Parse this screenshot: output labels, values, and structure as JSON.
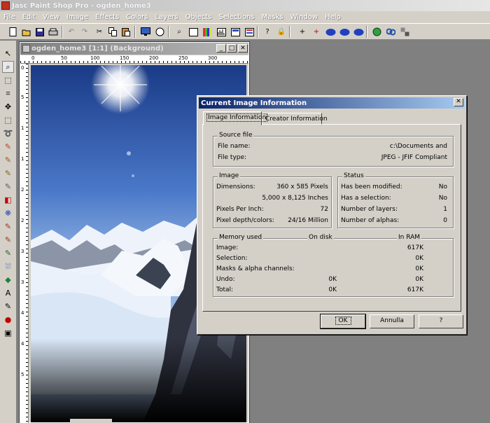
{
  "app": {
    "title": "Jasc Paint Shop Pro - ogden_home3"
  },
  "menu": [
    "File",
    "Edit",
    "View",
    "Image",
    "Effects",
    "Colors",
    "Layers",
    "Objects",
    "Selections",
    "Masks",
    "Window",
    "Help"
  ],
  "image_window": {
    "title": "ogden_home3 [1:1] (Background)",
    "minimize": "_",
    "maximize": "□",
    "close": "✕",
    "ruler_top": [
      "0",
      "50",
      "100",
      "150",
      "200",
      "250",
      "300"
    ],
    "ruler_left": [
      "0",
      "5",
      "1",
      "1",
      "2",
      "2",
      "3",
      "3",
      "4",
      "4",
      "5"
    ]
  },
  "dialog": {
    "title": "Current Image Information",
    "close": "✕",
    "tabs": [
      "Image Information",
      "Creator Information"
    ],
    "source": {
      "title": "Source file",
      "file_name_label": "File name:",
      "file_name": "c:\\Documents and",
      "file_type_label": "File type:",
      "file_type": "JPEG - JFIF Compliant"
    },
    "image": {
      "title": "Image",
      "dimensions_label": "Dimensions:",
      "dimensions_px": "360 x 585 Pixels",
      "dimensions_in": "5,000 x 8,125 Inches",
      "ppi_label": "Pixels Per Inch:",
      "ppi": "72",
      "depth_label": "Pixel depth/colors:",
      "depth": "24/16 Million"
    },
    "status": {
      "title": "Status",
      "modified_label": "Has been modified:",
      "modified": "No",
      "selection_label": "Has a selection:",
      "selection": "No",
      "layers_label": "Number of layers:",
      "layers": "1",
      "alphas_label": "Number of alphas:",
      "alphas": "0"
    },
    "memory": {
      "title": "Memory used",
      "col_disk": "On disk",
      "col_ram": "In RAM",
      "rows": [
        {
          "label": "Image:",
          "disk": "",
          "ram": "617K"
        },
        {
          "label": "Selection:",
          "disk": "",
          "ram": "0K"
        },
        {
          "label": "Masks & alpha channels:",
          "disk": "",
          "ram": "0K"
        },
        {
          "label": "Undo:",
          "disk": "0K",
          "ram": "0K"
        },
        {
          "label": "Total:",
          "disk": "0K",
          "ram": "617K"
        }
      ]
    },
    "buttons": {
      "ok": "OK",
      "cancel": "Annulla",
      "help": "?"
    }
  },
  "icons": [
    "new-icon",
    "open-icon",
    "save-icon",
    "print-icon",
    "undo-icon",
    "redo-icon",
    "cut-icon",
    "copy-icon",
    "paste-icon",
    "screen-icon",
    "browse-icon",
    "zoom-icon",
    "histogram-icon",
    "layers-icon",
    "script-icon",
    "help-icon",
    "lock-icon"
  ],
  "colors": {
    "dialog_title": "#0a246a",
    "face": "#d4d0c8",
    "workspace": "#808080"
  }
}
